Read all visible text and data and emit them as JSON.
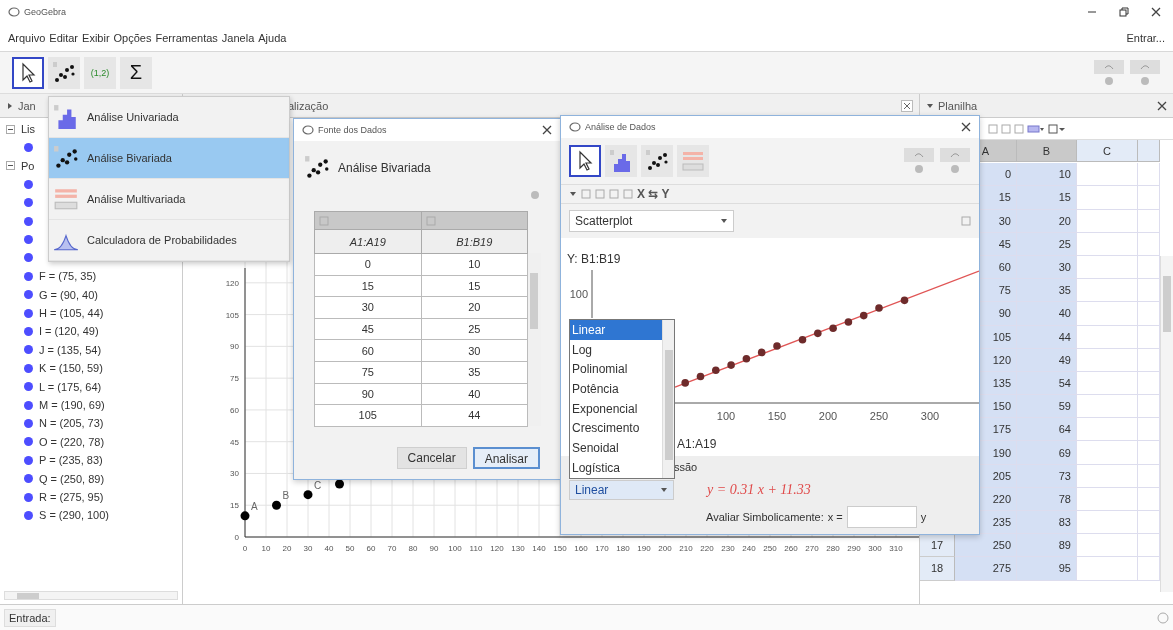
{
  "window": {
    "title": "GeoGebra"
  },
  "menu_bar": {
    "items": [
      "Arquivo",
      "Editar",
      "Exibir",
      "Opções",
      "Ferramentas",
      "Janela",
      "Ajuda"
    ],
    "sign_in": "Entrar..."
  },
  "toolbar": {
    "tools": [
      {
        "kind": "pointer",
        "selected": true
      },
      {
        "kind": "scatter",
        "selected": false
      },
      {
        "kind": "label",
        "label": "(1,2)",
        "selected": false
      },
      {
        "kind": "label",
        "label": "Σ",
        "selected": false
      }
    ]
  },
  "tool_menu": {
    "items": [
      {
        "kind": "histogram",
        "label": "Análise Univariada",
        "selected": false
      },
      {
        "kind": "scatter",
        "label": "Análise Bivariada",
        "selected": true
      },
      {
        "kind": "multivariate",
        "label": "Análise Multivariada",
        "selected": false
      },
      {
        "kind": "probability",
        "label": "Calculadora de Probabilidades",
        "selected": false
      }
    ]
  },
  "algebra": {
    "header": "Jan",
    "tree": [
      {
        "label": "Lis",
        "expanded": true,
        "children": [
          {
            "kind": "covered"
          }
        ]
      },
      {
        "label": "Po",
        "expanded": true,
        "children": [
          {
            "kind": "covered"
          },
          {
            "kind": "covered"
          },
          {
            "kind": "covered"
          },
          {
            "kind": "covered"
          },
          {
            "kind": "covered"
          },
          {
            "kind": "point",
            "label": "F = (75, 35)"
          },
          {
            "kind": "point",
            "label": "G = (90, 40)"
          },
          {
            "kind": "point",
            "label": "H = (105, 44)"
          },
          {
            "kind": "point",
            "label": "I = (120, 49)"
          },
          {
            "kind": "point",
            "label": "J = (135, 54)"
          },
          {
            "kind": "point",
            "label": "K = (150, 59)"
          },
          {
            "kind": "point",
            "label": "L = (175, 64)"
          },
          {
            "kind": "point",
            "label": "M = (190, 69)"
          },
          {
            "kind": "point",
            "label": "N = (205, 73)"
          },
          {
            "kind": "point",
            "label": "O = (220, 78)"
          },
          {
            "kind": "point",
            "label": "P = (235, 83)"
          },
          {
            "kind": "point",
            "label": "Q = (250, 89)"
          },
          {
            "kind": "point",
            "label": "R = (275, 95)"
          },
          {
            "kind": "point",
            "label": "S = (290, 100)"
          }
        ]
      }
    ]
  },
  "graphics": {
    "header": "alização",
    "chart_data": {
      "type": "scatter",
      "x": [
        0,
        15,
        30,
        45
      ],
      "series": [
        {
          "color": "#000000",
          "values": [
            10,
            15,
            20,
            25
          ]
        }
      ],
      "xlim": [
        0,
        321
      ],
      "ylim": [
        0,
        127
      ],
      "grid": true,
      "xticks": [
        0,
        10,
        20,
        30,
        40,
        50,
        60,
        70,
        80,
        90,
        100,
        110,
        120,
        130,
        140,
        150,
        160,
        170,
        180,
        190,
        200,
        210,
        220,
        230,
        240,
        250,
        260,
        270,
        280,
        290,
        300,
        310
      ],
      "yticks": [
        0,
        15,
        30,
        45,
        60,
        75,
        90,
        105,
        120
      ],
      "annotations": [
        {
          "x": 0,
          "y": 10,
          "text": "A"
        },
        {
          "x": 15,
          "y": 15,
          "text": "B"
        },
        {
          "x": 30,
          "y": 20,
          "text": "C"
        }
      ]
    }
  },
  "spreadsheet": {
    "header": "Planilha",
    "columns": [
      {
        "label": "A",
        "selected": true
      },
      {
        "label": "B",
        "selected": true
      },
      {
        "label": "C",
        "selected": false
      }
    ],
    "rows": [
      {
        "cells": [
          "0",
          "10"
        ]
      },
      {
        "cells": [
          "15",
          "15"
        ]
      },
      {
        "cells": [
          "30",
          "20"
        ]
      },
      {
        "cells": [
          "45",
          "25"
        ]
      },
      {
        "cells": [
          "60",
          "30"
        ]
      },
      {
        "cells": [
          "75",
          "35"
        ]
      },
      {
        "cells": [
          "90",
          "40"
        ]
      },
      {
        "cells": [
          "105",
          "44"
        ]
      },
      {
        "cells": [
          "120",
          "49"
        ]
      },
      {
        "cells": [
          "135",
          "54"
        ]
      },
      {
        "cells": [
          "150",
          "59"
        ]
      },
      {
        "cells": [
          "175",
          "64"
        ]
      },
      {
        "cells": [
          "190",
          "69"
        ]
      },
      {
        "cells": [
          "205",
          "73"
        ]
      },
      {
        "cells": [
          "220",
          "78"
        ]
      },
      {
        "cells": [
          "235",
          "83"
        ]
      },
      {
        "header": "17",
        "cells": [
          "250",
          "89"
        ]
      },
      {
        "header": "18",
        "cells": [
          "275",
          "95"
        ]
      }
    ]
  },
  "data_source_dialog": {
    "title": "Fonte dos Dados",
    "mode": "Análise Bivariada",
    "columns": [
      "A1:A19",
      "B1:B19"
    ],
    "rows": [
      [
        "0",
        "10"
      ],
      [
        "15",
        "15"
      ],
      [
        "30",
        "20"
      ],
      [
        "45",
        "25"
      ],
      [
        "60",
        "30"
      ],
      [
        "75",
        "35"
      ],
      [
        "90",
        "40"
      ],
      [
        "105",
        "44"
      ]
    ],
    "buttons": [
      {
        "label": "Cancelar",
        "default": false
      },
      {
        "label": "Analisar",
        "default": true
      }
    ]
  },
  "analysis_dialog": {
    "title": "Análise de Dados",
    "tools": [
      {
        "kind": "pointer",
        "selected": true
      },
      {
        "kind": "histogram",
        "selected": false
      },
      {
        "kind": "scatter",
        "selected": false
      },
      {
        "kind": "multivariate",
        "selected": false
      }
    ],
    "swap_label": "X ⇆ Y",
    "plot_type": "Scatterplot",
    "y_label": "Y: B1:B19",
    "x_label": "A1:A19",
    "plot": {
      "y_ticks": [
        "100"
      ],
      "x_ticks": [
        "100",
        "150",
        "200",
        "250",
        "300"
      ]
    },
    "regression": {
      "header": "ssão",
      "model": "Linear",
      "formula": "y = 0.31 x + 11.33",
      "options": [
        {
          "label": "Linear",
          "selected": true
        },
        {
          "label": "Log",
          "selected": false
        },
        {
          "label": "Polinomial",
          "selected": false
        },
        {
          "label": "Potência",
          "selected": false
        },
        {
          "label": "Exponencial",
          "selected": false
        },
        {
          "label": "Crescimento",
          "selected": false
        },
        {
          "label": "Senoidal",
          "selected": false
        },
        {
          "label": "Logística",
          "selected": false
        }
      ]
    },
    "evaluate": {
      "label": "Avaliar Simbolicamente:",
      "x_label": "x =",
      "y_label": "y"
    }
  },
  "input_bar": {
    "label": "Entrada:"
  }
}
